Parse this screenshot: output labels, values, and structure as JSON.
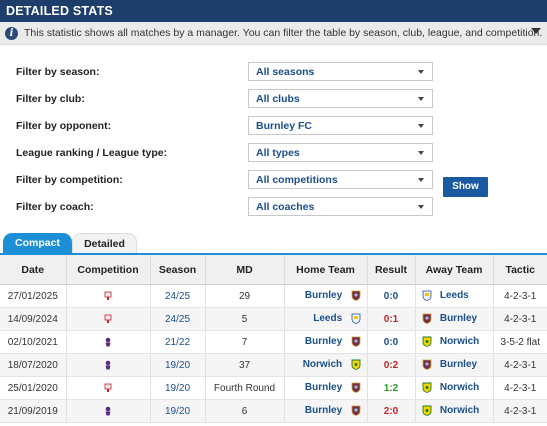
{
  "header": {
    "title": "DETAILED STATS"
  },
  "info": {
    "text": "This statistic shows all matches by a manager. You can filter the table by season, club, league, and competition."
  },
  "filters": [
    {
      "label": "Filter by season:",
      "value": "All seasons"
    },
    {
      "label": "Filter by club:",
      "value": "All clubs"
    },
    {
      "label": "Filter by opponent:",
      "value": "Burnley FC"
    },
    {
      "label": "League ranking / League type:",
      "value": "All types"
    },
    {
      "label": "Filter by competition:",
      "value": "All competitions"
    },
    {
      "label": "Filter by coach:",
      "value": "All coaches"
    }
  ],
  "show_button": "Show",
  "tabs": {
    "compact": "Compact",
    "detailed": "Detailed"
  },
  "table": {
    "headers": [
      "Date",
      "Competition",
      "Season",
      "MD",
      "Home Team",
      "Result",
      "Away Team",
      "Tactic"
    ],
    "rows": [
      {
        "date": "27/01/2025",
        "competition_icon": "fa-cup-icon",
        "season": "24/25",
        "md": "29",
        "home": "Burnley",
        "home_crest": "burnley-crest-icon",
        "result": "0:0",
        "result_type": "draw",
        "away": "Leeds",
        "away_crest": "leeds-crest-icon",
        "tactic": "4-2-3-1"
      },
      {
        "date": "14/09/2024",
        "competition_icon": "fa-cup-icon",
        "season": "24/25",
        "md": "5",
        "home": "Leeds",
        "home_crest": "leeds-crest-icon",
        "result": "0:1",
        "result_type": "loss",
        "away": "Burnley",
        "away_crest": "burnley-crest-icon",
        "tactic": "4-2-3-1"
      },
      {
        "date": "02/10/2021",
        "competition_icon": "premier-league-icon",
        "season": "21/22",
        "md": "7",
        "home": "Burnley",
        "home_crest": "burnley-crest-icon",
        "result": "0:0",
        "result_type": "draw",
        "away": "Norwich",
        "away_crest": "norwich-crest-icon",
        "tactic": "3-5-2 flat"
      },
      {
        "date": "18/07/2020",
        "competition_icon": "premier-league-icon",
        "season": "19/20",
        "md": "37",
        "home": "Norwich",
        "home_crest": "norwich-crest-icon",
        "result": "0:2",
        "result_type": "loss",
        "away": "Burnley",
        "away_crest": "burnley-crest-icon",
        "tactic": "4-2-3-1"
      },
      {
        "date": "25/01/2020",
        "competition_icon": "fa-cup-icon",
        "season": "19/20",
        "md": "Fourth Round",
        "home": "Burnley",
        "home_crest": "burnley-crest-icon",
        "result": "1:2",
        "result_type": "drawgreen",
        "away": "Norwich",
        "away_crest": "norwich-crest-icon",
        "tactic": "4-2-3-1"
      },
      {
        "date": "21/09/2019",
        "competition_icon": "premier-league-icon",
        "season": "19/20",
        "md": "6",
        "home": "Burnley",
        "home_crest": "burnley-crest-icon",
        "result": "2:0",
        "result_type": "loss",
        "away": "Norwich",
        "away_crest": "norwich-crest-icon",
        "tactic": "4-2-3-1"
      }
    ]
  },
  "colors": {
    "header_bg": "#1d3d6b",
    "accent_blue": "#1d8fd6",
    "link": "#1a4f8a",
    "win": "#2e9a2e",
    "loss": "#c0242b",
    "burnley": "#7a2a48",
    "leeds": "#f2f2f2",
    "norwich": "#f5d400"
  }
}
